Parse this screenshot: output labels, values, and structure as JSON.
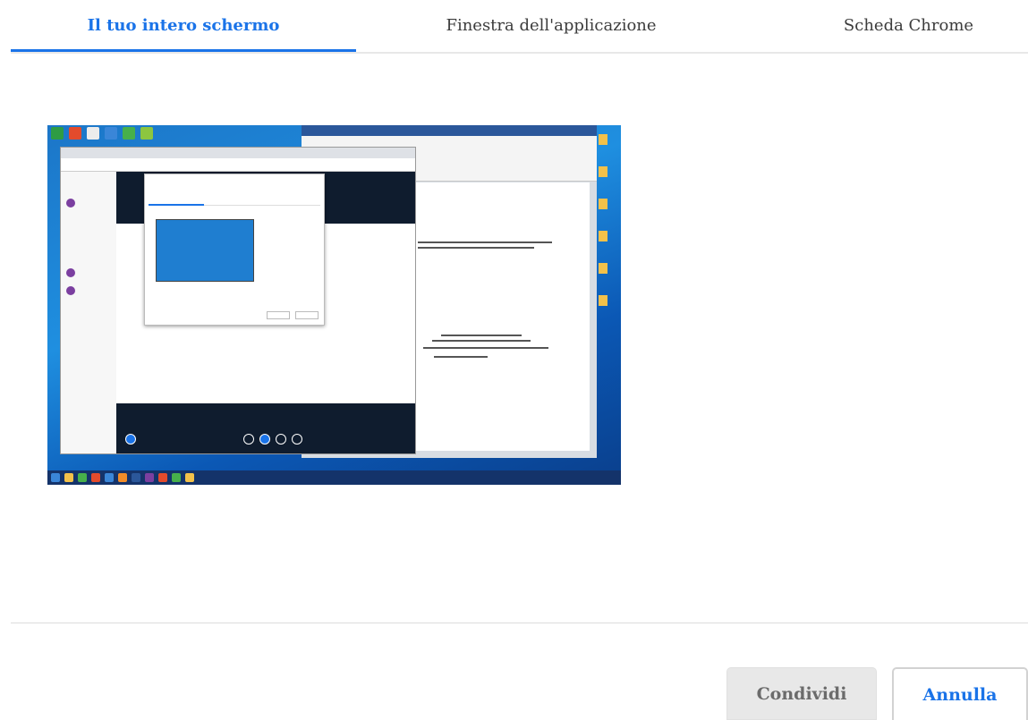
{
  "tabs": [
    {
      "label": "Il tuo intero schermo",
      "active": true
    },
    {
      "label": "Finestra dell'applicazione",
      "active": false
    },
    {
      "label": "Scheda Chrome",
      "active": false
    }
  ],
  "preview": {
    "icon": "screen-thumbnail"
  },
  "buttons": {
    "share_label": "Condividi",
    "cancel_label": "Annulla"
  },
  "colors": {
    "accent": "#1a73e8",
    "disabled_button_bg": "#e8e8e8",
    "disabled_button_text": "#6b6b6b"
  }
}
